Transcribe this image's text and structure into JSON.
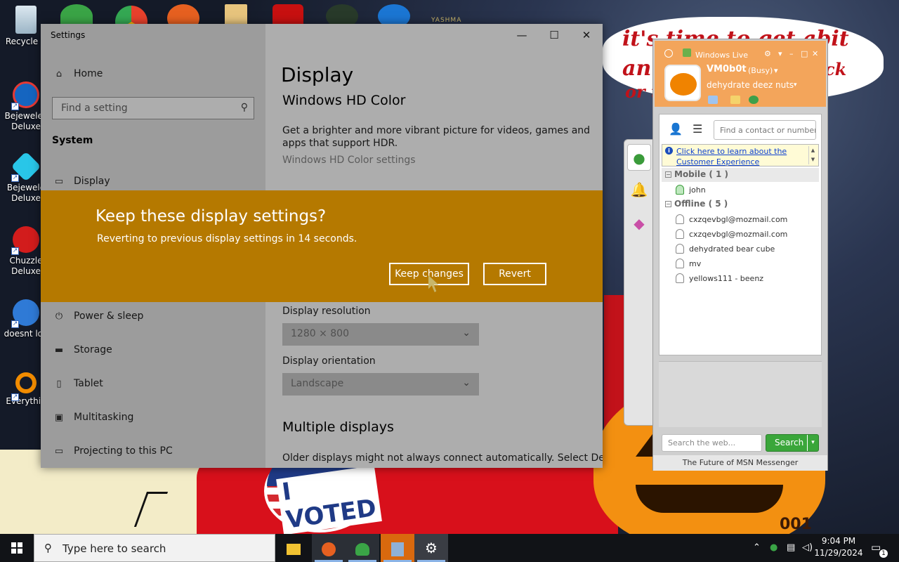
{
  "desktop": {
    "icons": [
      {
        "label": "Recycle B"
      },
      {
        "label": "Bejewelec Deluxe"
      },
      {
        "label": "Bejewele Deluxe"
      },
      {
        "label": "Chuzzle Deluxe"
      },
      {
        "label": "doesnt loa"
      },
      {
        "label": "Everythin"
      }
    ],
    "wallpaper_text": {
      "line1": "it's time to get abit",
      "line2": "an",
      "line3": "ck",
      "line4": "or t",
      "badge": "I VOTED",
      "corner": "YASHMA",
      "number": "001"
    }
  },
  "settings": {
    "window_title": "Settings",
    "controls": {
      "minimize": "—",
      "maximize": "☐",
      "close": "✕"
    },
    "home_label": "Home",
    "search_placeholder": "Find a setting",
    "section": "System",
    "nav": {
      "display": "Display",
      "power": "Power & sleep",
      "storage": "Storage",
      "tablet": "Tablet",
      "multitasking": "Multitasking",
      "projecting": "Projecting to this PC"
    },
    "content": {
      "heading": "Display",
      "subheading": "Windows HD Color",
      "hd_desc": "Get a brighter and more vibrant picture for videos, games and apps that support HDR.",
      "hd_link": "Windows HD Color settings",
      "resolution_label": "Display resolution",
      "resolution_value": "1280 × 800",
      "orientation_label": "Display orientation",
      "orientation_value": "Landscape",
      "multiple_heading": "Multiple displays",
      "multiple_desc": "Older displays might not always connect automatically. Select Detect"
    }
  },
  "dialog": {
    "question": "Keep these display settings?",
    "countdown": "Reverting to previous display settings in 14 seconds.",
    "keep_label": "Keep changes",
    "revert_label": "Revert"
  },
  "messenger": {
    "title": "Windows Live",
    "name": "VM0b0t",
    "status": "(Busy)",
    "personal_message": "dehydrate deez nuts",
    "find_placeholder": "Find a contact or number",
    "notice": "Click here to learn about the Customer Experience",
    "groups": [
      {
        "label": "Mobile ( 1 )",
        "contacts": [
          "john"
        ]
      },
      {
        "label": "Offline ( 5 )",
        "contacts": [
          "cxzqevbgl@mozmail.com",
          "cxzqevbgl@mozmail.com",
          "dehydrated bear cube",
          "mv",
          "yellows111 - beenz"
        ]
      }
    ],
    "web_placeholder": "Search the web...",
    "search_label": "Search",
    "footer": "The Future of MSN Messenger"
  },
  "taskbar": {
    "search_placeholder": "Type here to search",
    "time": "9:04 PM",
    "date": "11/29/2024",
    "notification_count": "1"
  },
  "colors": {
    "dialog_bg": "#b57900",
    "messenger_header": "#f3a55b",
    "sidebar_bg": "#e6e6e6",
    "taskbar_bg": "#111317"
  }
}
